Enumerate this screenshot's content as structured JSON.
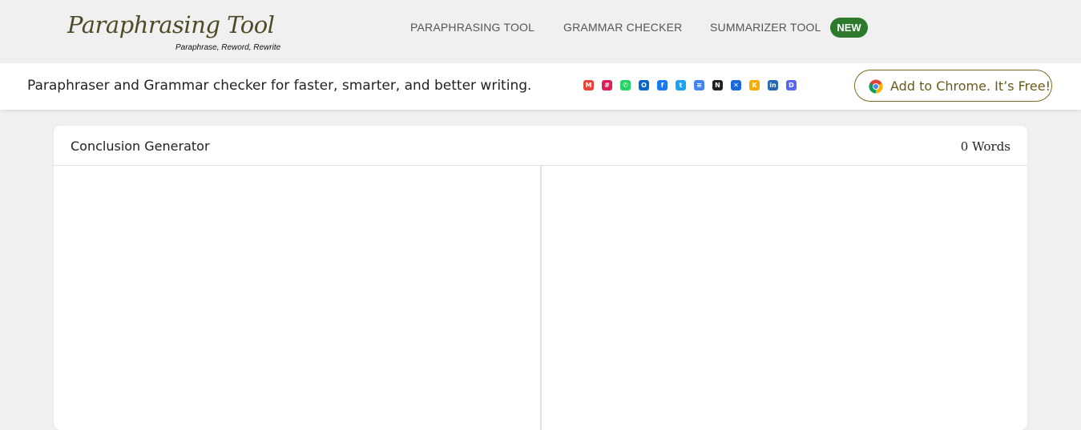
{
  "logo": {
    "script": "Paraphrasing Tool",
    "tagline": "Paraphrase, Reword, Rewrite"
  },
  "nav": {
    "paraphrasing": "PARAPHRASING TOOL",
    "grammar": "GRAMMAR CHECKER",
    "summarizer": "SUMMARIZER TOOL",
    "badge": "NEW"
  },
  "banner": {
    "text": "Paraphraser and Grammar checker for faster, smarter, and better writing.",
    "icons": [
      {
        "name": "gmail-icon",
        "glyph": "M",
        "color": "#ea4335"
      },
      {
        "name": "slack-icon",
        "glyph": "#",
        "color": "#e01e5a"
      },
      {
        "name": "whatsapp-icon",
        "glyph": "✆",
        "color": "#25d366"
      },
      {
        "name": "outlook-icon",
        "glyph": "O",
        "color": "#0a64c9"
      },
      {
        "name": "facebook-icon",
        "glyph": "f",
        "color": "#1877f2"
      },
      {
        "name": "twitter-icon",
        "glyph": "t",
        "color": "#1da1f2"
      },
      {
        "name": "google-docs-icon",
        "glyph": "≡",
        "color": "#4285f4"
      },
      {
        "name": "notion-icon",
        "glyph": "N",
        "color": "#222222"
      },
      {
        "name": "confluence-icon",
        "glyph": "✕",
        "color": "#1868db"
      },
      {
        "name": "google-keep-icon",
        "glyph": "K",
        "color": "#f9ab00"
      },
      {
        "name": "linkedin-icon",
        "glyph": "in",
        "color": "#2867b2"
      },
      {
        "name": "discord-icon",
        "glyph": "D",
        "color": "#5865f2"
      }
    ],
    "chrome_button": "Add to Chrome. It’s Free!"
  },
  "card": {
    "title": "Conclusion Generator",
    "word_count": "0 Words",
    "input_value": ""
  },
  "colors": {
    "badge": "#2d7a2d",
    "chrome_border": "#7a6a1e",
    "background": "#f0f0f0"
  }
}
